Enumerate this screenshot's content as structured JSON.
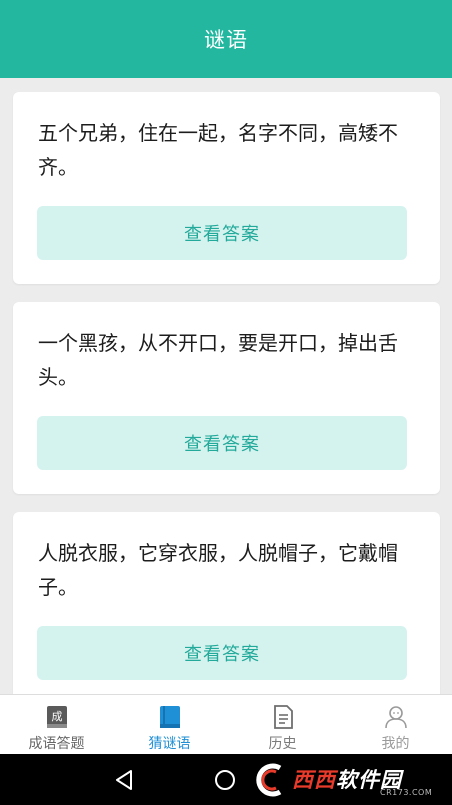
{
  "header": {
    "title": "谜语",
    "background_color": "#23b79f"
  },
  "riddles": [
    {
      "text": "五个兄弟，住在一起，名字不同，高矮不齐。",
      "button_label": "查看答案"
    },
    {
      "text": "一个黑孩，从不开口，要是开口，掉出舌头。",
      "button_label": "查看答案"
    },
    {
      "text": "人脱衣服，它穿衣服，人脱帽子，它戴帽子。",
      "button_label": "查看答案"
    }
  ],
  "tabbar": {
    "active_color": "#1f8fd6",
    "items": [
      {
        "label": "成语答题",
        "icon": "idiom-book-icon",
        "icon_glyph": "成"
      },
      {
        "label": "猜谜语",
        "icon": "open-book-icon"
      },
      {
        "label": "历史",
        "icon": "document-icon"
      },
      {
        "label": "我的",
        "icon": "user-icon"
      }
    ]
  },
  "system_nav": {
    "back_icon": "back-triangle-icon",
    "home_icon": "home-circle-icon"
  },
  "watermark": {
    "brand_red": "西西",
    "brand_white": "软件园",
    "site": "CR173.COM"
  }
}
